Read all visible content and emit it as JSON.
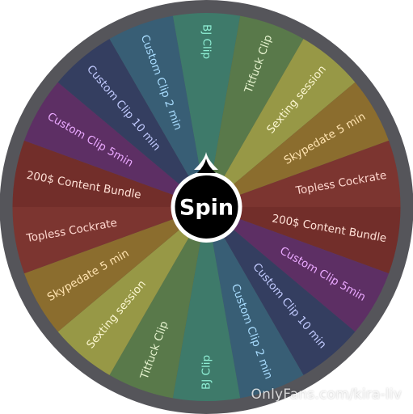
{
  "wheel": {
    "spin_label": "Spin",
    "segments": [
      {
        "label": "BJ Clip",
        "color": "#3e7a6a",
        "text_color": "#8ff0d6"
      },
      {
        "label": "Titfuck Clip",
        "color": "#59794a",
        "text_color": "#e6f3cf"
      },
      {
        "label": "Sexting session",
        "color": "#979846",
        "text_color": "#fbf6cf"
      },
      {
        "label": "Skypedate 5 min",
        "color": "#8b6d2e",
        "text_color": "#ffe3b0"
      },
      {
        "label": "Topless Cockrate",
        "color": "#7c3530",
        "text_color": "#ffd7cf"
      },
      {
        "label": "200$ Content Bundle",
        "color": "#722e2a",
        "text_color": "#ffe0d6"
      },
      {
        "label": "Custom Clip 5min",
        "color": "#5d2f64",
        "text_color": "#eaa8ff"
      },
      {
        "label": "Custom Clip 10 min",
        "color": "#343e60",
        "text_color": "#c2cbff"
      },
      {
        "label": "Custom Clip 2 min",
        "color": "#385e75",
        "text_color": "#a9ddff"
      },
      {
        "label": "BJ Clip",
        "color": "#3e7a6a",
        "text_color": "#8ff0d6"
      },
      {
        "label": "Titfuck Clip",
        "color": "#59794a",
        "text_color": "#e6f3cf"
      },
      {
        "label": "Sexting session",
        "color": "#979846",
        "text_color": "#fbf6cf"
      },
      {
        "label": "Skypedate 5 min",
        "color": "#8b6d2e",
        "text_color": "#ffe3b0"
      },
      {
        "label": "Topless Cockrate",
        "color": "#7c3530",
        "text_color": "#ffd7cf"
      },
      {
        "label": "200$ Content Bundle",
        "color": "#722e2a",
        "text_color": "#ffe0d6"
      },
      {
        "label": "Custom Clip 5min",
        "color": "#5d2f64",
        "text_color": "#eaa8ff"
      },
      {
        "label": "Custom Clip 10 min",
        "color": "#343e60",
        "text_color": "#c2cbff"
      },
      {
        "label": "Custom Clip 2 min",
        "color": "#385e75",
        "text_color": "#a9ddff"
      }
    ]
  },
  "watermark": "OnlyFans.com/kira-liv",
  "colors": {
    "rim": "#55555a",
    "hub": "#000000",
    "hub_ring": "#ffffff"
  }
}
